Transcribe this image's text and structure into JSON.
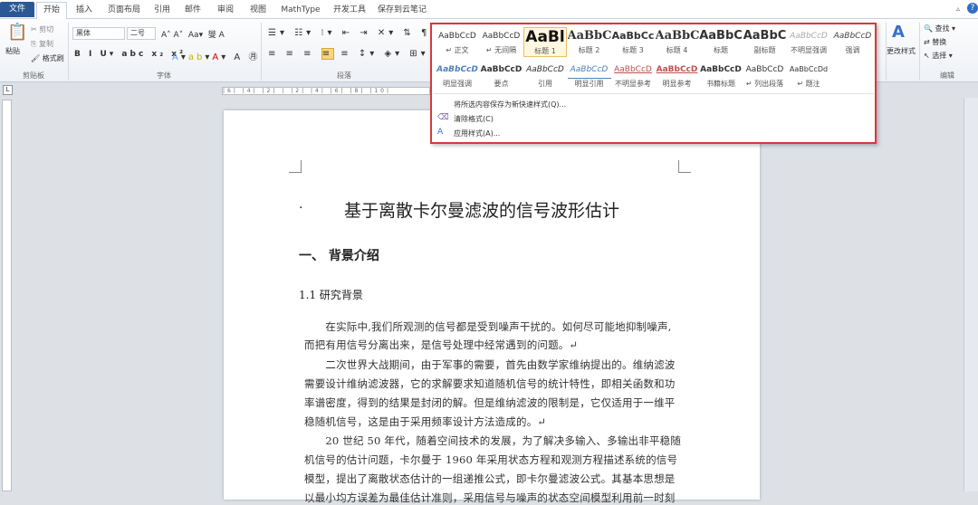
{
  "tabs": [
    "文件",
    "开始",
    "插入",
    "页面布局",
    "引用",
    "邮件",
    "审阅",
    "视图",
    "MathType",
    "开发工具",
    "保存到云笔记"
  ],
  "clipboard": {
    "paste": "粘贴",
    "cut": "剪切",
    "copy": "复制",
    "format_painter": "格式刷",
    "label": "剪贴板"
  },
  "font": {
    "name": "黑体",
    "size": "二号",
    "label": "字体"
  },
  "paragraph": {
    "label": "段落"
  },
  "editing": {
    "change_styles": "更改样式",
    "find": "查找",
    "replace": "替换",
    "select": "选择",
    "label": "编辑"
  },
  "styles_row1": [
    {
      "preview": "AaBbCcD",
      "name": "↵ 正文"
    },
    {
      "preview": "AaBbCcD",
      "name": "↵ 无间隔"
    },
    {
      "preview": "AaBl",
      "name": "标题 1"
    },
    {
      "preview": "AaBbC",
      "name": "标题 2"
    },
    {
      "preview": "AaBbCc",
      "name": "标题 3"
    },
    {
      "preview": "AaBbC",
      "name": "标题 4"
    },
    {
      "preview": "AaBbC",
      "name": "标题"
    },
    {
      "preview": "AaBbC",
      "name": "副标题"
    },
    {
      "preview": "AaBbCcD",
      "name": "不明显强调"
    },
    {
      "preview": "AaBbCcD",
      "name": "强调"
    }
  ],
  "styles_row2": [
    {
      "preview": "AaBbCcD",
      "name": "明显强调"
    },
    {
      "preview": "AaBbCcD",
      "name": "要点"
    },
    {
      "preview": "AaBbCcD",
      "name": "引用"
    },
    {
      "preview": "AaBbCcD",
      "name": "明显引用"
    },
    {
      "preview": "AaBbCcD",
      "name": "不明显参考"
    },
    {
      "preview": "AaBbCcD",
      "name": "明显参考"
    },
    {
      "preview": "AaBbCcD",
      "name": "书籍标题"
    },
    {
      "preview": "AaBbCcD",
      "name": "↵ 列出段落"
    },
    {
      "preview": "AaBbCcDd",
      "name": "↵ 题注"
    }
  ],
  "menu": [
    "将所选内容保存为新快速样式(Q)...",
    "清除格式(C)",
    "应用样式(A)..."
  ],
  "ruler_text": "|6| |4| |2| | |2| |4| |6| |8| |10|",
  "doc": {
    "title": "基于离散卡尔曼滤波的信号波形估计",
    "h1": "一、  背景介绍",
    "h2": "1.1  研究背景",
    "lines": [
      "　　在实际中,我们所观测的信号都是受到噪声干扰的。如何尽可能地抑制噪声,",
      "而把有用信号分离出来，是信号处理中经常遇到的问题。↵",
      "　　二次世界大战期间，由于军事的需要，首先由数学家维纳提出的。维纳滤波",
      "需要设计维纳滤波器，它的求解要求知道随机信号的统计特性，即相关函数和功",
      "率谱密度，得到的结果是封闭的解。但是维纳滤波的限制是，它仅适用于一维平",
      "稳随机信号，这是由于采用频率设计方法造成的。↵",
      "　　20 世纪 50 年代，随着空间技术的发展，为了解决多输入、多输出非平稳随",
      "机信号的估计问题，卡尔曼于 1960 年采用状态方程和观测方程描述系统的信号",
      "模型，提出了离散状态估计的一组递推公式，即卡尔曼滤波公式。其基本思想是",
      "以最小均方误差为最佳估计准则，采用信号与噪声的状态空间模型利用前一时刻"
    ]
  }
}
